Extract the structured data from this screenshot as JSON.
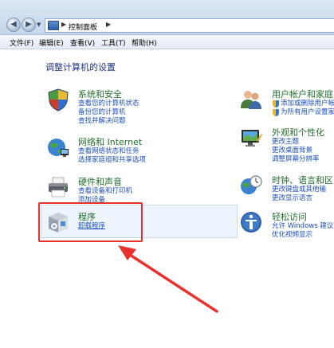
{
  "address": {
    "crumb": "控制面板"
  },
  "menu": [
    "文件(F)",
    "编辑(E)",
    "查看(V)",
    "工具(T)",
    "帮助(H)"
  ],
  "heading": "调整计算机的设置",
  "categories": {
    "system": {
      "title": "系统和安全",
      "links": [
        "查看您的计算机状态",
        "备份您的计算机",
        "查找并解决问题"
      ]
    },
    "network": {
      "title": "网络和 Internet",
      "links": [
        "查看网络状态和任务",
        "选择家庭组和共享选项"
      ]
    },
    "hardware": {
      "title": "硬件和声音",
      "links": [
        "查看设备和打印机",
        "添加设备"
      ]
    },
    "programs": {
      "title": "程序",
      "links": [
        "卸载程序"
      ]
    },
    "users": {
      "title": "用户帐户和家庭",
      "links": [
        "添加或删除用户帐",
        "为所有用户设置家"
      ]
    },
    "appearance": {
      "title": "外观和个性化",
      "links": [
        "更改主题",
        "更改桌面背景",
        "调整屏幕分辨率"
      ]
    },
    "clock": {
      "title": "时钟、语言和区",
      "links": [
        "更改键盘或其他输",
        "更改显示语言"
      ]
    },
    "access": {
      "title": "轻松访问",
      "links": [
        "允许 Windows 建议",
        "优化视频显示"
      ]
    }
  },
  "colors": {
    "title": "#1e6e2a",
    "link": "#1a4fc0",
    "heading": "#1e3287",
    "highlight": "#e8312d"
  }
}
